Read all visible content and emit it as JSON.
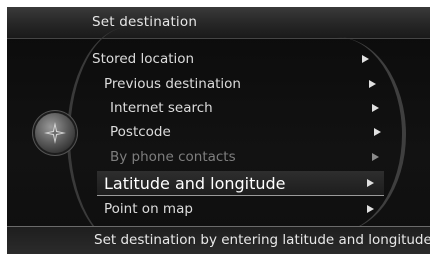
{
  "header": {
    "title": "Set destination"
  },
  "controls": {
    "knob_icon": "navigation-compass-icon"
  },
  "menu": {
    "items": [
      {
        "label": "Stored location",
        "state": "normal"
      },
      {
        "label": "Previous destination",
        "state": "normal"
      },
      {
        "label": "Internet search",
        "state": "normal"
      },
      {
        "label": "Postcode",
        "state": "normal"
      },
      {
        "label": "By phone contacts",
        "state": "disabled"
      },
      {
        "label": "Latitude and longitude",
        "state": "selected"
      },
      {
        "label": "Point on map",
        "state": "normal"
      }
    ]
  },
  "footer": {
    "help_text": "Set destination by entering latitude and longitude"
  }
}
